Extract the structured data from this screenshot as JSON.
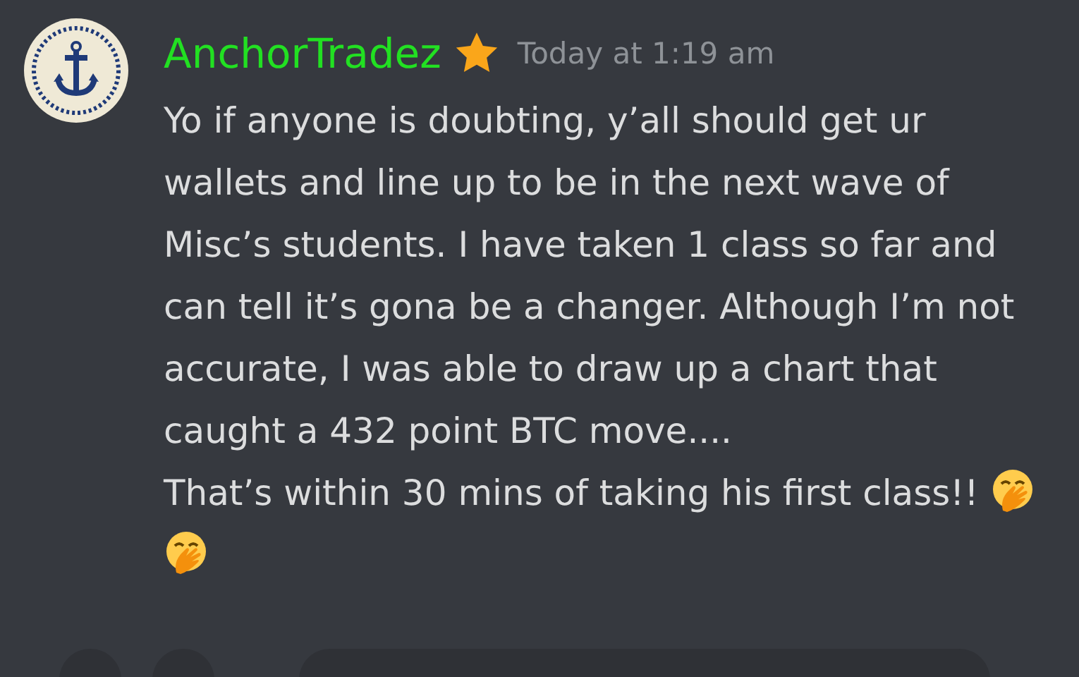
{
  "message": {
    "author": "AnchorTradez",
    "timestamp": "Today at 1:19 am",
    "paragraphs": [
      "Yo if anyone is doubting, y’all should get ur wallets and line up to be in the next wave of Misc’s students. I have taken 1 class so far and can tell it’s gona be a changer. Although I’m not accurate, I was able to draw up a chart that caught a 432 point BTC move....",
      "That’s within 30 mins of taking his first class!!"
    ]
  }
}
